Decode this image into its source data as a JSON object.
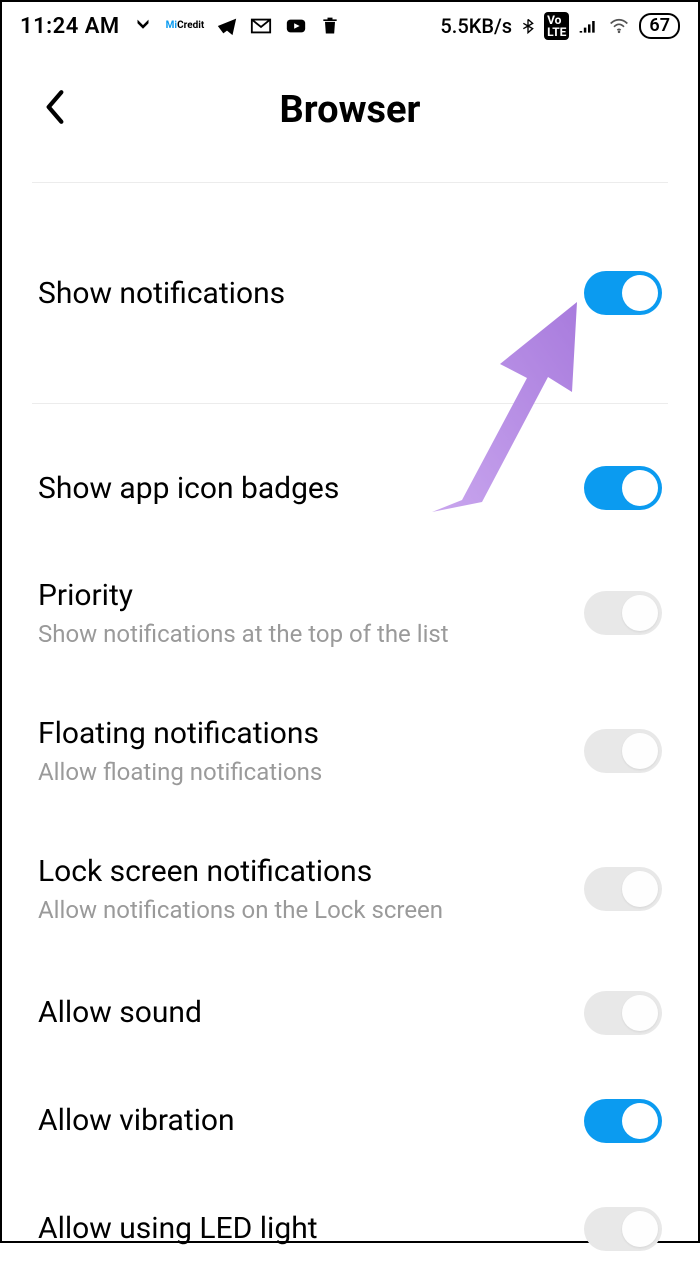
{
  "statusbar": {
    "time": "11:24 AM",
    "data_rate": "5.5KB/s",
    "battery": "67",
    "volte": "Vo LTE"
  },
  "header": {
    "title": "Browser"
  },
  "settings": {
    "show_notifications": {
      "label": "Show notifications",
      "on": true
    },
    "show_badges": {
      "label": "Show app icon badges",
      "on": true
    },
    "priority": {
      "label": "Priority",
      "sub": "Show notifications at the top of the list",
      "on": false
    },
    "floating": {
      "label": "Floating notifications",
      "sub": "Allow floating notifications",
      "on": false
    },
    "lockscreen": {
      "label": "Lock screen notifications",
      "sub": "Allow notifications on the Lock screen",
      "on": false
    },
    "sound": {
      "label": "Allow sound",
      "on": false
    },
    "vibration": {
      "label": "Allow vibration",
      "on": true
    },
    "led": {
      "label": "Allow using LED light",
      "on": false
    }
  },
  "colors": {
    "accent": "#0b9bf0",
    "toggle_off": "#e8e8e8",
    "subtext": "#9a9a9a",
    "annotation": "#b78ce8"
  }
}
